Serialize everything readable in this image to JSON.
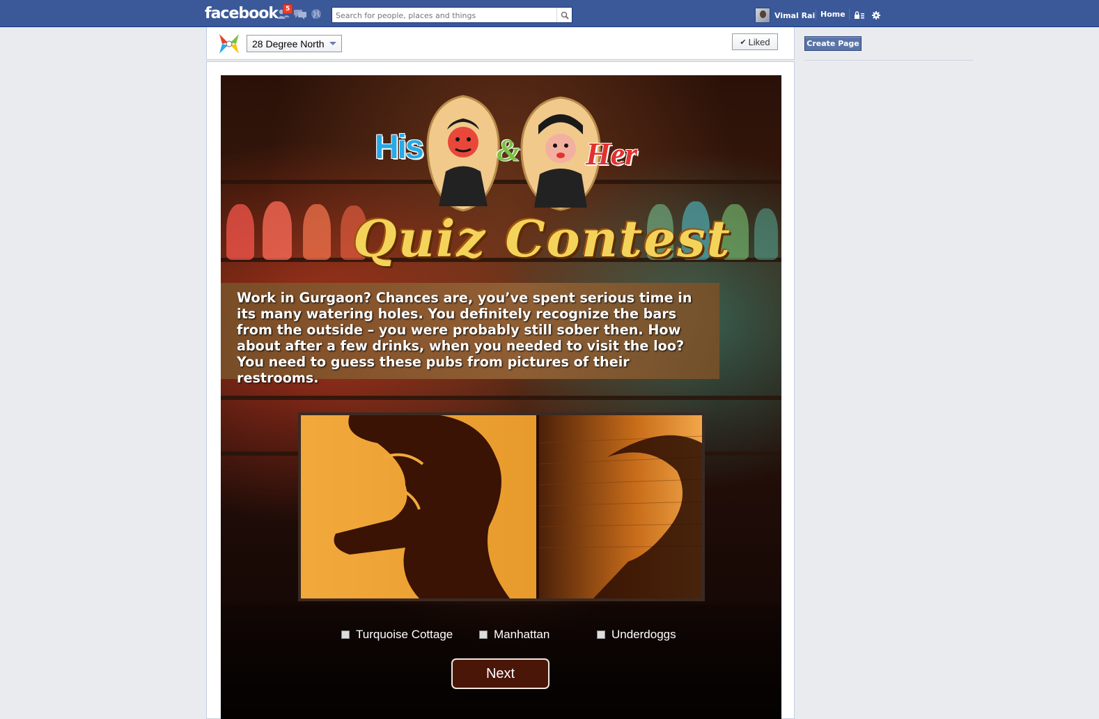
{
  "topbar": {
    "logo": "facebook",
    "friend_requests_count": "5",
    "search_placeholder": "Search for people, places and things",
    "user_name": "Vimal Rai",
    "home_label": "Home"
  },
  "page": {
    "name": "28 Degree North",
    "liked_label": "Liked"
  },
  "sidebar": {
    "create_page_label": "Create Page"
  },
  "app": {
    "his_label": "His",
    "amp_label": "&",
    "her_label": "Her",
    "title": "Quiz Contest",
    "intro": "Work in Gurgaon? Chances are, you’ve spent serious time in its many watering holes. You definitely recognize the bars from the outside – you were probably still sober then. How about after a few drinks, when you needed to visit the loo? You need to guess these pubs from pictures of their restrooms.",
    "options": [
      "Turquoise Cottage",
      "Manhattan",
      "Underdoggs"
    ],
    "next_label": "Next"
  },
  "icons": {
    "friends": "friend-requests-icon",
    "messages": "messages-icon",
    "notifications": "globe-icon",
    "search": "search-icon",
    "privacy": "privacy-shortcuts-icon",
    "settings": "gear-icon"
  },
  "colors": {
    "brand": "#3b5998",
    "badge": "#f03d25",
    "his": "#29a9e6",
    "her": "#e2322f",
    "amp": "#7ac143",
    "title": "#f4d35a"
  }
}
